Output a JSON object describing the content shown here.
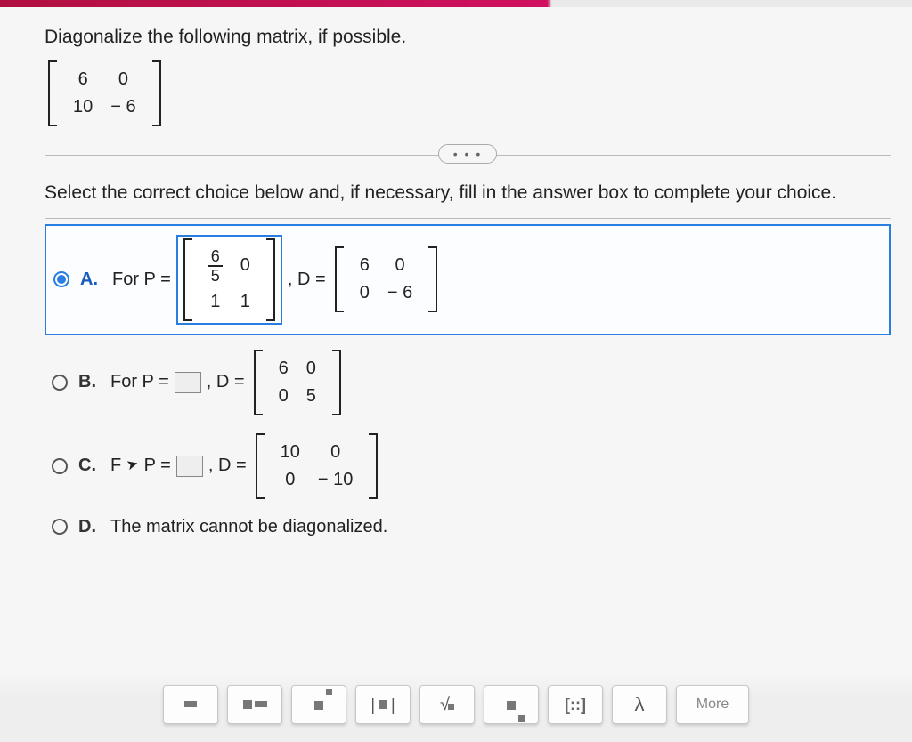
{
  "question": {
    "prompt": "Diagonalize the following matrix, if possible.",
    "matrix": [
      [
        "6",
        "0"
      ],
      [
        "10",
        "− 6"
      ]
    ]
  },
  "expand_dots": "• • •",
  "instruction": "Select the correct choice below and, if necessary, fill in the answer box to complete your choice.",
  "choices": {
    "A": {
      "label": "A.",
      "lead": "For P =",
      "P": [
        [
          "6/5",
          "0"
        ],
        [
          "1",
          "1"
        ]
      ],
      "mid": ", D =",
      "D": [
        [
          "6",
          "0"
        ],
        [
          "0",
          "− 6"
        ]
      ],
      "selected": true
    },
    "B": {
      "label": "B.",
      "lead": "For P =",
      "mid": ", D =",
      "D": [
        [
          "6",
          "0"
        ],
        [
          "0",
          "5"
        ]
      ]
    },
    "C": {
      "label": "C.",
      "lead": "For P =",
      "lead_override": "F",
      "cursor_after_lead": "➤",
      "lead_tail": "P =",
      "mid": ", D =",
      "D": [
        [
          "10",
          "0"
        ],
        [
          "0",
          "− 10"
        ]
      ]
    },
    "D": {
      "label": "D.",
      "text": "The matrix cannot be diagonalized."
    }
  },
  "palette": {
    "frac": "frac",
    "mixed": "mixed",
    "exp": "exp",
    "abs": "|■|",
    "sqrt": "√",
    "sub": "sub",
    "matrix": "[::]",
    "lambda": "λ",
    "more": "More"
  }
}
